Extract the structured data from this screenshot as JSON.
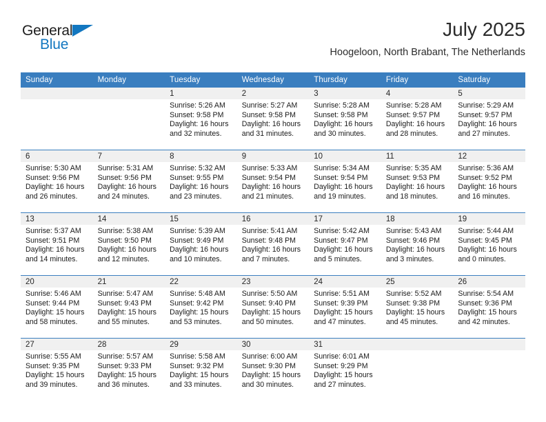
{
  "brand": {
    "name_part1": "General",
    "name_part2": "Blue",
    "accent_color": "#1277c0"
  },
  "header": {
    "month_title": "July 2025",
    "location": "Hoogeloon, North Brabant, The Netherlands",
    "header_bar_color": "#3a7ebf"
  },
  "weekday_headers": [
    "Sunday",
    "Monday",
    "Tuesday",
    "Wednesday",
    "Thursday",
    "Friday",
    "Saturday"
  ],
  "weeks": [
    [
      {
        "day": "",
        "sunrise": "",
        "sunset": "",
        "daylight_1": "",
        "daylight_2": "",
        "empty": true
      },
      {
        "day": "",
        "sunrise": "",
        "sunset": "",
        "daylight_1": "",
        "daylight_2": "",
        "empty": true
      },
      {
        "day": "1",
        "sunrise": "Sunrise: 5:26 AM",
        "sunset": "Sunset: 9:58 PM",
        "daylight_1": "Daylight: 16 hours",
        "daylight_2": "and 32 minutes."
      },
      {
        "day": "2",
        "sunrise": "Sunrise: 5:27 AM",
        "sunset": "Sunset: 9:58 PM",
        "daylight_1": "Daylight: 16 hours",
        "daylight_2": "and 31 minutes."
      },
      {
        "day": "3",
        "sunrise": "Sunrise: 5:28 AM",
        "sunset": "Sunset: 9:58 PM",
        "daylight_1": "Daylight: 16 hours",
        "daylight_2": "and 30 minutes."
      },
      {
        "day": "4",
        "sunrise": "Sunrise: 5:28 AM",
        "sunset": "Sunset: 9:57 PM",
        "daylight_1": "Daylight: 16 hours",
        "daylight_2": "and 28 minutes."
      },
      {
        "day": "5",
        "sunrise": "Sunrise: 5:29 AM",
        "sunset": "Sunset: 9:57 PM",
        "daylight_1": "Daylight: 16 hours",
        "daylight_2": "and 27 minutes."
      }
    ],
    [
      {
        "day": "6",
        "sunrise": "Sunrise: 5:30 AM",
        "sunset": "Sunset: 9:56 PM",
        "daylight_1": "Daylight: 16 hours",
        "daylight_2": "and 26 minutes."
      },
      {
        "day": "7",
        "sunrise": "Sunrise: 5:31 AM",
        "sunset": "Sunset: 9:56 PM",
        "daylight_1": "Daylight: 16 hours",
        "daylight_2": "and 24 minutes."
      },
      {
        "day": "8",
        "sunrise": "Sunrise: 5:32 AM",
        "sunset": "Sunset: 9:55 PM",
        "daylight_1": "Daylight: 16 hours",
        "daylight_2": "and 23 minutes."
      },
      {
        "day": "9",
        "sunrise": "Sunrise: 5:33 AM",
        "sunset": "Sunset: 9:54 PM",
        "daylight_1": "Daylight: 16 hours",
        "daylight_2": "and 21 minutes."
      },
      {
        "day": "10",
        "sunrise": "Sunrise: 5:34 AM",
        "sunset": "Sunset: 9:54 PM",
        "daylight_1": "Daylight: 16 hours",
        "daylight_2": "and 19 minutes."
      },
      {
        "day": "11",
        "sunrise": "Sunrise: 5:35 AM",
        "sunset": "Sunset: 9:53 PM",
        "daylight_1": "Daylight: 16 hours",
        "daylight_2": "and 18 minutes."
      },
      {
        "day": "12",
        "sunrise": "Sunrise: 5:36 AM",
        "sunset": "Sunset: 9:52 PM",
        "daylight_1": "Daylight: 16 hours",
        "daylight_2": "and 16 minutes."
      }
    ],
    [
      {
        "day": "13",
        "sunrise": "Sunrise: 5:37 AM",
        "sunset": "Sunset: 9:51 PM",
        "daylight_1": "Daylight: 16 hours",
        "daylight_2": "and 14 minutes."
      },
      {
        "day": "14",
        "sunrise": "Sunrise: 5:38 AM",
        "sunset": "Sunset: 9:50 PM",
        "daylight_1": "Daylight: 16 hours",
        "daylight_2": "and 12 minutes."
      },
      {
        "day": "15",
        "sunrise": "Sunrise: 5:39 AM",
        "sunset": "Sunset: 9:49 PM",
        "daylight_1": "Daylight: 16 hours",
        "daylight_2": "and 10 minutes."
      },
      {
        "day": "16",
        "sunrise": "Sunrise: 5:41 AM",
        "sunset": "Sunset: 9:48 PM",
        "daylight_1": "Daylight: 16 hours",
        "daylight_2": "and 7 minutes."
      },
      {
        "day": "17",
        "sunrise": "Sunrise: 5:42 AM",
        "sunset": "Sunset: 9:47 PM",
        "daylight_1": "Daylight: 16 hours",
        "daylight_2": "and 5 minutes."
      },
      {
        "day": "18",
        "sunrise": "Sunrise: 5:43 AM",
        "sunset": "Sunset: 9:46 PM",
        "daylight_1": "Daylight: 16 hours",
        "daylight_2": "and 3 minutes."
      },
      {
        "day": "19",
        "sunrise": "Sunrise: 5:44 AM",
        "sunset": "Sunset: 9:45 PM",
        "daylight_1": "Daylight: 16 hours",
        "daylight_2": "and 0 minutes."
      }
    ],
    [
      {
        "day": "20",
        "sunrise": "Sunrise: 5:46 AM",
        "sunset": "Sunset: 9:44 PM",
        "daylight_1": "Daylight: 15 hours",
        "daylight_2": "and 58 minutes."
      },
      {
        "day": "21",
        "sunrise": "Sunrise: 5:47 AM",
        "sunset": "Sunset: 9:43 PM",
        "daylight_1": "Daylight: 15 hours",
        "daylight_2": "and 55 minutes."
      },
      {
        "day": "22",
        "sunrise": "Sunrise: 5:48 AM",
        "sunset": "Sunset: 9:42 PM",
        "daylight_1": "Daylight: 15 hours",
        "daylight_2": "and 53 minutes."
      },
      {
        "day": "23",
        "sunrise": "Sunrise: 5:50 AM",
        "sunset": "Sunset: 9:40 PM",
        "daylight_1": "Daylight: 15 hours",
        "daylight_2": "and 50 minutes."
      },
      {
        "day": "24",
        "sunrise": "Sunrise: 5:51 AM",
        "sunset": "Sunset: 9:39 PM",
        "daylight_1": "Daylight: 15 hours",
        "daylight_2": "and 47 minutes."
      },
      {
        "day": "25",
        "sunrise": "Sunrise: 5:52 AM",
        "sunset": "Sunset: 9:38 PM",
        "daylight_1": "Daylight: 15 hours",
        "daylight_2": "and 45 minutes."
      },
      {
        "day": "26",
        "sunrise": "Sunrise: 5:54 AM",
        "sunset": "Sunset: 9:36 PM",
        "daylight_1": "Daylight: 15 hours",
        "daylight_2": "and 42 minutes."
      }
    ],
    [
      {
        "day": "27",
        "sunrise": "Sunrise: 5:55 AM",
        "sunset": "Sunset: 9:35 PM",
        "daylight_1": "Daylight: 15 hours",
        "daylight_2": "and 39 minutes."
      },
      {
        "day": "28",
        "sunrise": "Sunrise: 5:57 AM",
        "sunset": "Sunset: 9:33 PM",
        "daylight_1": "Daylight: 15 hours",
        "daylight_2": "and 36 minutes."
      },
      {
        "day": "29",
        "sunrise": "Sunrise: 5:58 AM",
        "sunset": "Sunset: 9:32 PM",
        "daylight_1": "Daylight: 15 hours",
        "daylight_2": "and 33 minutes."
      },
      {
        "day": "30",
        "sunrise": "Sunrise: 6:00 AM",
        "sunset": "Sunset: 9:30 PM",
        "daylight_1": "Daylight: 15 hours",
        "daylight_2": "and 30 minutes."
      },
      {
        "day": "31",
        "sunrise": "Sunrise: 6:01 AM",
        "sunset": "Sunset: 9:29 PM",
        "daylight_1": "Daylight: 15 hours",
        "daylight_2": "and 27 minutes."
      },
      {
        "day": "",
        "sunrise": "",
        "sunset": "",
        "daylight_1": "",
        "daylight_2": "",
        "empty": true
      },
      {
        "day": "",
        "sunrise": "",
        "sunset": "",
        "daylight_1": "",
        "daylight_2": "",
        "empty": true
      }
    ]
  ]
}
